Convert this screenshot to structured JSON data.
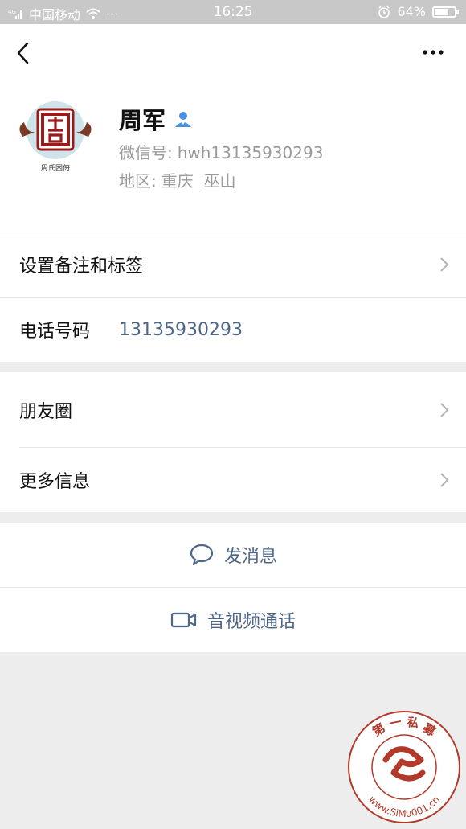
{
  "status_bar": {
    "carrier": "中国移动",
    "time": "16:25",
    "battery": "64%",
    "battery_level": 0.64,
    "dots": "···"
  },
  "profile": {
    "name": "周军",
    "wechat_id_label": "微信号:",
    "wechat_id": "hwh13135930293",
    "region_label": "地区:",
    "region": "重庆  巫山",
    "avatar_caption": "周氏困倚"
  },
  "rows": {
    "remark": "设置备注和标签",
    "phone_label": "电话号码",
    "phone_value": "13135930293",
    "moments": "朋友圈",
    "more_info": "更多信息"
  },
  "actions": {
    "send_message": "发消息",
    "video_call": "音视频通话"
  },
  "watermark": {
    "top_text": "第 一 私 募",
    "bottom_text": "www.SiMu001.cn"
  },
  "colors": {
    "link_blue": "#4e6787",
    "gray_text": "#9a9a9a",
    "status_bar": "#c8c8c8",
    "watermark_red": "#b23a2a"
  },
  "icons": [
    "signal-icon",
    "wifi-icon",
    "alarm-icon",
    "battery-icon",
    "back-icon",
    "more-icon",
    "verified-user-icon",
    "chevron-right-icon",
    "chat-bubble-icon",
    "video-camera-icon"
  ]
}
